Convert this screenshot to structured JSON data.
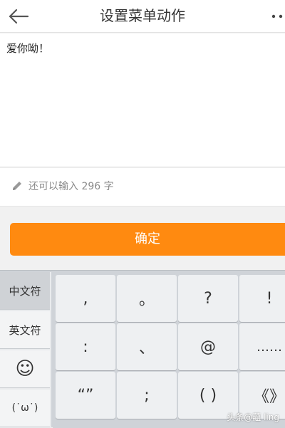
{
  "header": {
    "title": "设置菜单动作",
    "back_icon": "arrow-left-icon",
    "more_icon": "more-dots-icon"
  },
  "editor": {
    "text": "爱你呦！"
  },
  "hint": {
    "icon": "pencil-icon",
    "text": "还可以输入 296 字"
  },
  "confirm": {
    "label": "确定",
    "color": "#ff8a10"
  },
  "keyboard": {
    "side_tabs": [
      {
        "label": "中文符",
        "active": true
      },
      {
        "label": "英文符",
        "active": false
      },
      {
        "label": "☺",
        "active": false
      },
      {
        "label": "(˙ω˙)",
        "active": false
      }
    ],
    "keys": [
      [
        ",",
        "。",
        "?",
        "!"
      ],
      [
        ":",
        "、",
        "@",
        "……"
      ],
      [
        "“”",
        ";",
        "( )",
        "《》"
      ]
    ]
  },
  "watermark": {
    "text": "头条@蘊 ling"
  }
}
